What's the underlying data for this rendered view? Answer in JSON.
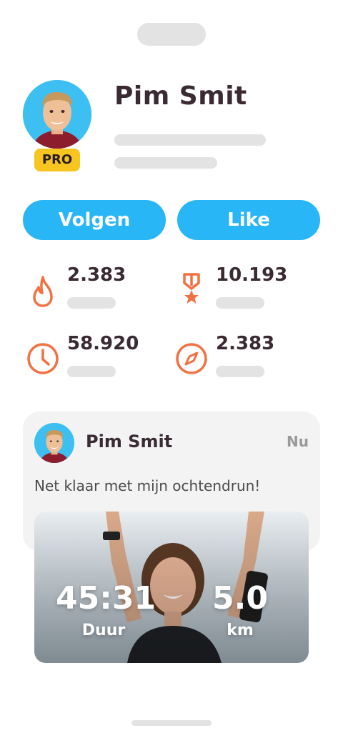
{
  "profile": {
    "name": "Pim Smit",
    "badge": "PRO"
  },
  "actions": {
    "follow_label": "Volgen",
    "like_label": "Like"
  },
  "stats": [
    {
      "icon": "flame-icon",
      "value": "2.383"
    },
    {
      "icon": "medal-icon",
      "value": "10.193"
    },
    {
      "icon": "clock-icon",
      "value": "58.920"
    },
    {
      "icon": "compass-icon",
      "value": "2.383"
    }
  ],
  "post": {
    "author": "Pim Smit",
    "time": "Nu",
    "text": "Net klaar met mijn ochtendrun!",
    "duration_value": "45:31",
    "duration_label": "Duur",
    "distance_value": "5.0",
    "distance_label": "km"
  },
  "colors": {
    "accent_blue": "#29b6f6",
    "accent_orange": "#f27142",
    "badge_yellow": "#f7c520",
    "text_dark": "#3a2a33",
    "skeleton": "#e3e3e3"
  }
}
